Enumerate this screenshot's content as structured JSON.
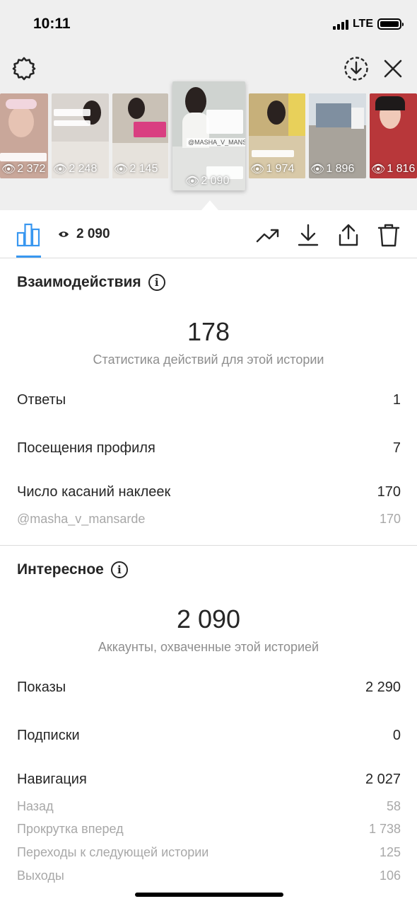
{
  "status_bar": {
    "time": "10:11",
    "network": "LTE"
  },
  "top_bar": {
    "settings_icon": "gear-icon",
    "download_icon": "download-circle-icon",
    "close_icon": "close-icon"
  },
  "stories": [
    {
      "views": "2 372",
      "bg": "#c9a79a"
    },
    {
      "views": "2 248",
      "bg": "#d9d4cf"
    },
    {
      "views": "2 145",
      "bg": "#c9c1b6"
    },
    {
      "views": "2 090",
      "bg": "#cfd3d0",
      "active": true,
      "sticker": "@MASHA_V_MANSARDE"
    },
    {
      "views": "1 974",
      "bg": "#c7b07a"
    },
    {
      "views": "1 896",
      "bg": "#a8a39b"
    },
    {
      "views": "1 816",
      "bg": "#b8373a"
    }
  ],
  "toolbar": {
    "views": "2 090"
  },
  "interactions": {
    "title": "Взаимодействия",
    "total": "178",
    "caption": "Статистика действий для этой истории",
    "rows": [
      {
        "label": "Ответы",
        "value": "1"
      },
      {
        "label": "Посещения профиля",
        "value": "7"
      },
      {
        "label": "Число касаний наклеек",
        "value": "170"
      }
    ],
    "sub_rows": [
      {
        "label": "@masha_v_mansarde",
        "value": "170"
      }
    ]
  },
  "discovery": {
    "title": "Интересное",
    "total": "2 090",
    "caption": "Аккаунты, охваченные этой историей",
    "rows": [
      {
        "label": "Показы",
        "value": "2 290"
      },
      {
        "label": "Подписки",
        "value": "0"
      },
      {
        "label": "Навигация",
        "value": "2 027"
      }
    ],
    "sub_rows": [
      {
        "label": "Назад",
        "value": "58"
      },
      {
        "label": "Прокрутка вперед",
        "value": "1 738"
      },
      {
        "label": "Переходы к следующей истории",
        "value": "125"
      },
      {
        "label": "Выходы",
        "value": "106"
      }
    ]
  },
  "colors": {
    "accent": "#3897f0",
    "text": "#262626",
    "secondary": "#8e8e8e",
    "background_top": "#efefef"
  }
}
